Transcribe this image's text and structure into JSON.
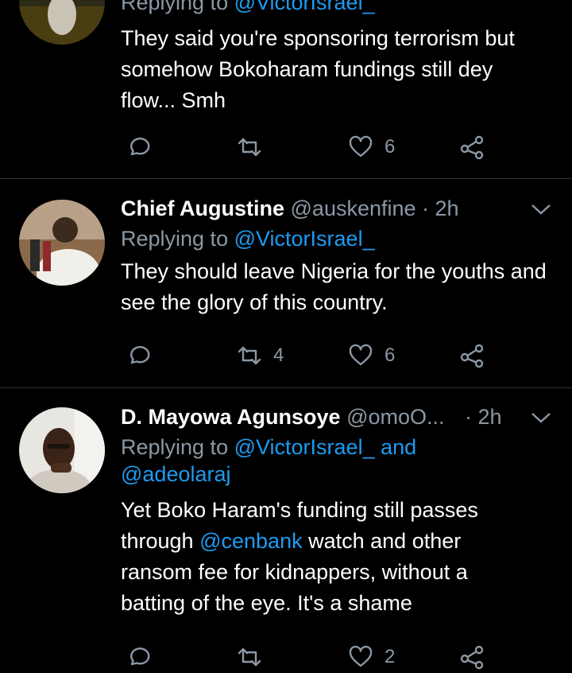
{
  "tweets": [
    {
      "name": "",
      "handle": "",
      "time": "",
      "reply_prefix": "Replying to",
      "reply_to": "@VictorIsrael_",
      "text": "They said you're sponsoring terrorism but somehow Bokoharam fundings still dey flow... Smh",
      "retweets": "",
      "likes": "6"
    },
    {
      "name": "Chief Augustine",
      "handle": "@auskenfine",
      "time": "· 2h",
      "reply_prefix": "Replying to",
      "reply_to": "@VictorIsrael_",
      "text": "They should leave Nigeria for the youths and see the glory of this country.",
      "retweets": "4",
      "likes": "6"
    },
    {
      "name": "D. Mayowa Agunsoye",
      "handle": "@omoO...",
      "time": "· 2h",
      "reply_prefix": "Replying to",
      "reply_to": "@VictorIsrael_",
      "reply_and": "and",
      "reply_to_2": "@adeolaraj",
      "text_1": "Yet Boko Haram's funding still passes through",
      "mention_in_text": "@cenbank",
      "text_2": "watch and other ransom fee for kidnappers, without a batting of the eye. It's a shame",
      "retweets": "",
      "likes": "2"
    }
  ],
  "colors": {
    "background": "#000000",
    "muted": "#8b98a5",
    "link": "#1d9bf0",
    "divider": "#2f3336"
  },
  "icons": [
    "reply-icon",
    "retweet-icon",
    "like-icon",
    "share-icon",
    "chevron-down-icon"
  ]
}
